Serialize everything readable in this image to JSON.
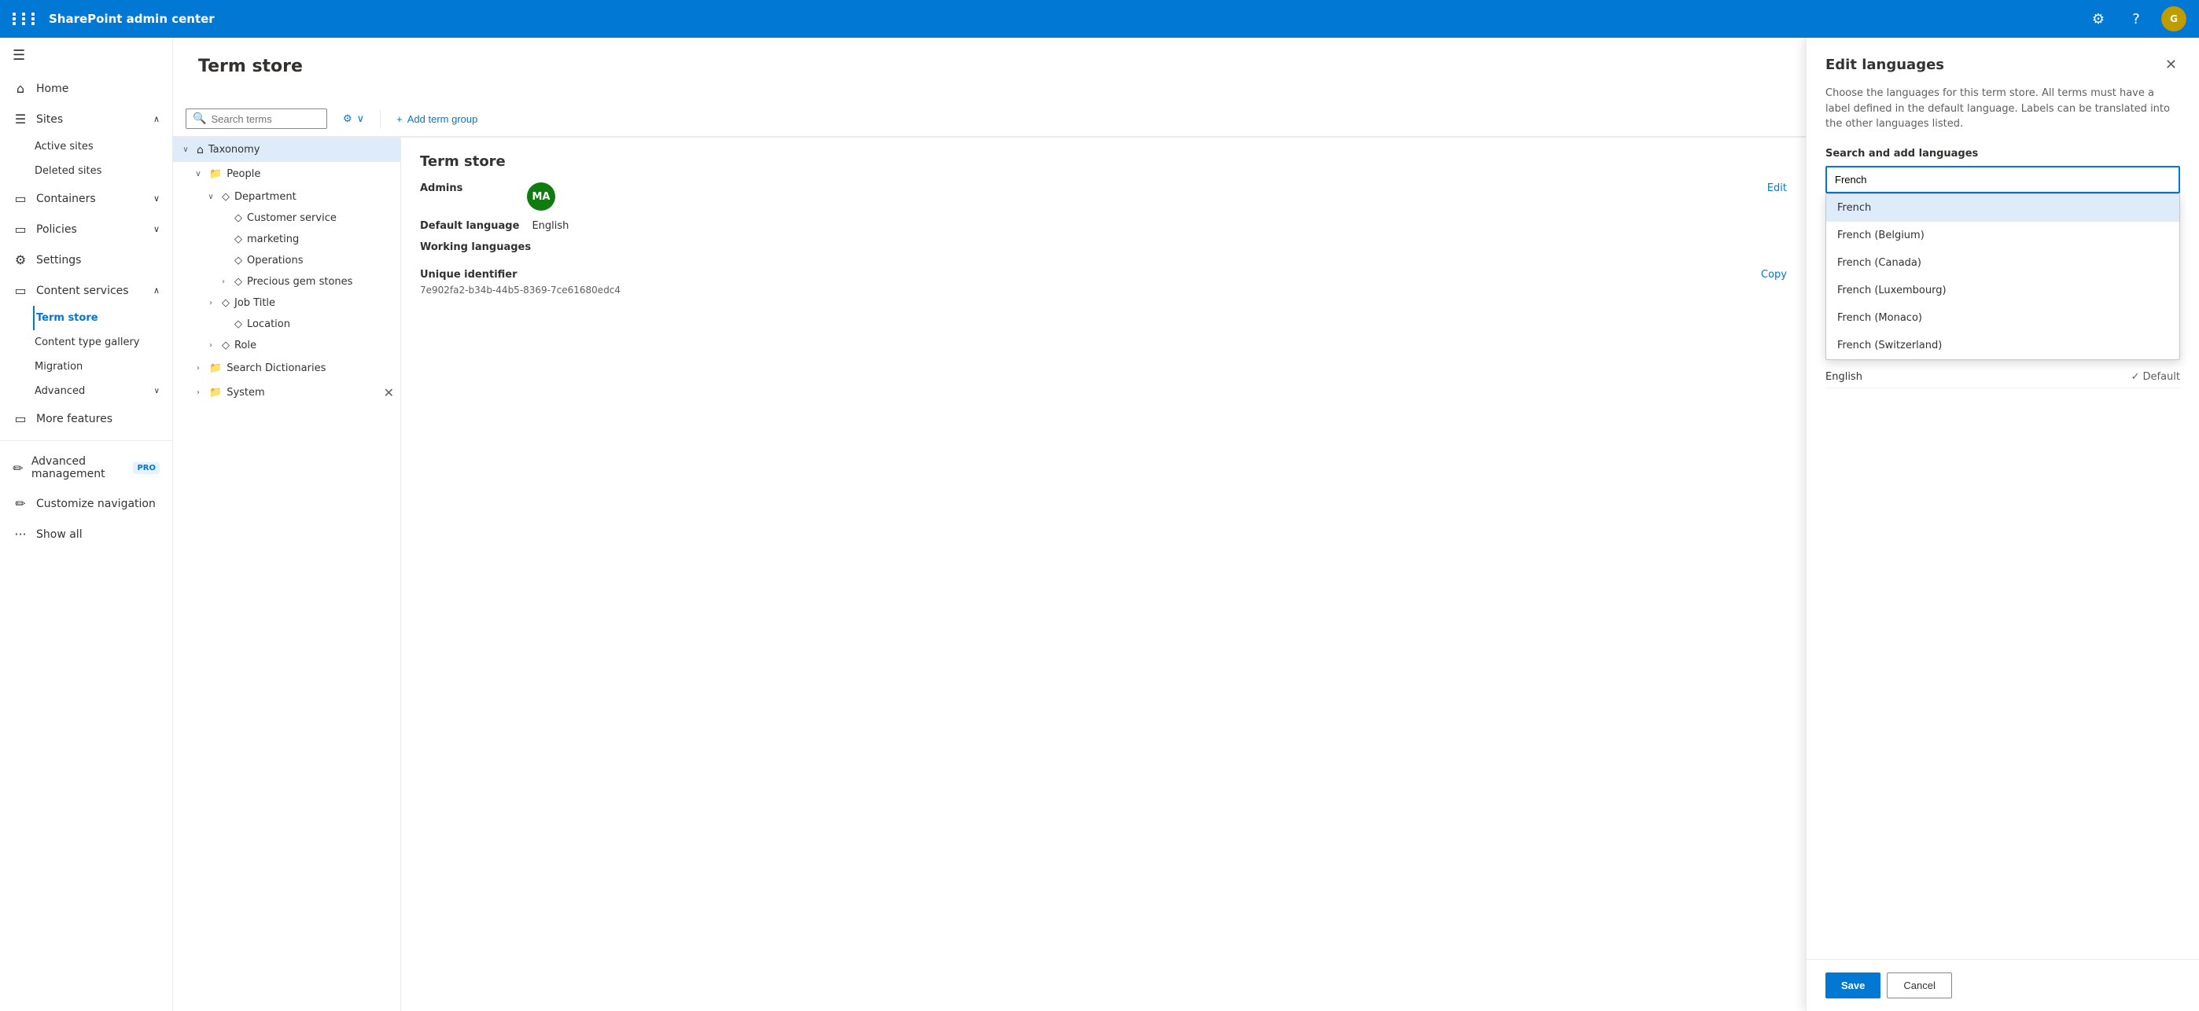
{
  "topbar": {
    "app_icon": "⊞",
    "title": "SharePoint admin center",
    "settings_icon": "⚙",
    "help_icon": "?",
    "avatar_initials": "G"
  },
  "sidebar": {
    "hamburger": "☰",
    "items": [
      {
        "id": "home",
        "icon": "⌂",
        "label": "Home",
        "active": false
      },
      {
        "id": "sites",
        "icon": "▭",
        "label": "Sites",
        "active": false,
        "expanded": true
      },
      {
        "id": "active-sites",
        "label": "Active sites",
        "sub": true,
        "active": false
      },
      {
        "id": "deleted-sites",
        "label": "Deleted sites",
        "sub": true,
        "active": false
      },
      {
        "id": "containers",
        "icon": "▭",
        "label": "Containers",
        "active": false,
        "hasChevron": true
      },
      {
        "id": "policies",
        "icon": "▭",
        "label": "Policies",
        "active": false,
        "hasChevron": true
      },
      {
        "id": "settings",
        "icon": "⚙",
        "label": "Settings",
        "active": false
      },
      {
        "id": "content-services",
        "icon": "▭",
        "label": "Content services",
        "active": false,
        "expanded": true
      },
      {
        "id": "term-store",
        "label": "Term store",
        "sub": true,
        "active": true
      },
      {
        "id": "content-type-gallery",
        "label": "Content type gallery",
        "sub": true,
        "active": false
      },
      {
        "id": "migration",
        "label": "Migration",
        "sub": true,
        "active": false
      },
      {
        "id": "advanced",
        "label": "Advanced",
        "sub": true,
        "active": false,
        "hasChevron": true
      },
      {
        "id": "more-features",
        "icon": "▭",
        "label": "More features",
        "active": false
      },
      {
        "id": "advanced-management",
        "icon": "✏",
        "label": "Advanced management",
        "active": false,
        "pro": true
      },
      {
        "id": "customize-navigation",
        "icon": "✏",
        "label": "Customize navigation",
        "active": false
      },
      {
        "id": "show-all",
        "icon": "···",
        "label": "Show all",
        "active": false
      }
    ]
  },
  "term_store": {
    "page_title": "Term store",
    "search_placeholder": "Search terms",
    "add_term_group": "Add term group",
    "detail_title": "Term store",
    "admins_label": "Admins",
    "edit_label": "Edit",
    "admin_initials": "MA",
    "default_language_label": "Default language",
    "default_language_value": "English",
    "working_languages_label": "Working languages",
    "unique_id_label": "Unique identifier",
    "unique_id_value": "7e902fa2-b34b-44b5-8369-7ce61680edc4",
    "copy_label": "Copy",
    "tree": [
      {
        "id": "taxonomy",
        "label": "Taxonomy",
        "level": 0,
        "icon": "⌂",
        "expanded": true,
        "hasMore": true
      },
      {
        "id": "people",
        "label": "People",
        "level": 1,
        "icon": "📁",
        "expanded": true,
        "hasMore": true,
        "hasExpand": true
      },
      {
        "id": "department",
        "label": "Department",
        "level": 2,
        "icon": "◇",
        "expanded": true,
        "hasExpand": true
      },
      {
        "id": "customer-service",
        "label": "Customer service",
        "level": 3,
        "icon": "◇"
      },
      {
        "id": "marketing",
        "label": "marketing",
        "level": 3,
        "icon": "◇"
      },
      {
        "id": "operations",
        "label": "Operations",
        "level": 3,
        "icon": "◇"
      },
      {
        "id": "precious-gem-stones",
        "label": "Precious gem stones",
        "level": 3,
        "icon": "◇",
        "hasExpand": true
      },
      {
        "id": "job-title",
        "label": "Job Title",
        "level": 2,
        "icon": "◇",
        "hasExpand": true
      },
      {
        "id": "location",
        "label": "Location",
        "level": 3,
        "icon": "◇"
      },
      {
        "id": "role",
        "label": "Role",
        "level": 2,
        "icon": "◇",
        "hasExpand": true
      },
      {
        "id": "search-dictionaries",
        "label": "Search Dictionaries",
        "level": 1,
        "icon": "📁",
        "hasExpand": true,
        "hasMore": true
      },
      {
        "id": "system",
        "label": "System",
        "level": 1,
        "icon": "📁",
        "hasExpand": true,
        "hasX": true
      }
    ]
  },
  "edit_languages": {
    "title": "Edit languages",
    "description": "Choose the languages for this term store. All terms must have a label defined in the default language. Labels can be translated into the other languages listed.",
    "search_label": "Search and add languages",
    "search_value": "French",
    "search_value_selected": true,
    "dropdown_items": [
      {
        "id": "french",
        "label": "French",
        "highlighted": true
      },
      {
        "id": "french-belgium",
        "label": "French (Belgium)"
      },
      {
        "id": "french-canada",
        "label": "French (Canada)"
      },
      {
        "id": "french-luxembourg",
        "label": "French (Luxembourg)"
      },
      {
        "id": "french-monaco",
        "label": "French (Monaco)"
      },
      {
        "id": "french-switzerland",
        "label": "French (Switzerland)"
      }
    ],
    "working_languages": [
      {
        "label": "English",
        "is_default": true,
        "default_label": "Default"
      }
    ],
    "save_label": "Save",
    "cancel_label": "Cancel"
  }
}
